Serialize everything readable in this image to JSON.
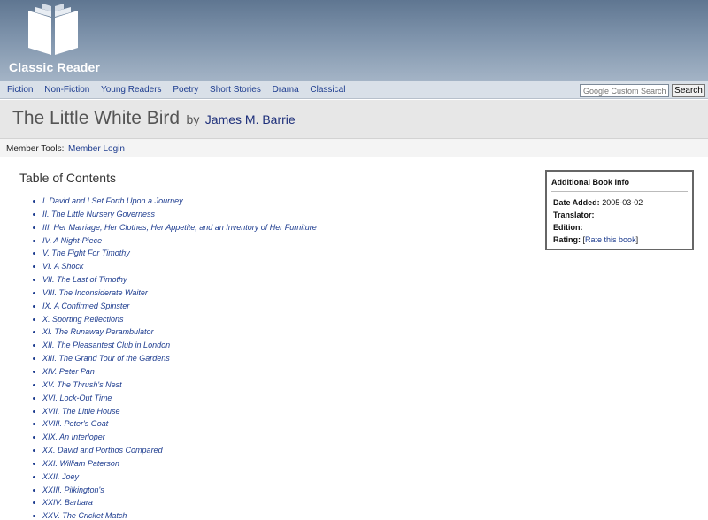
{
  "header": {
    "logo_text": "Classic Reader"
  },
  "nav": {
    "links": [
      "Fiction",
      "Non-Fiction",
      "Young Readers",
      "Poetry",
      "Short Stories",
      "Drama",
      "Classical"
    ],
    "search_placeholder": "Google Custom Search",
    "search_button": "Search"
  },
  "book": {
    "title": "The Little White Bird",
    "by": "by",
    "author": "James M. Barrie"
  },
  "member": {
    "label": "Member Tools:",
    "login": "Member Login"
  },
  "toc": {
    "heading": "Table of Contents",
    "chapters": [
      "I. David and I Set Forth Upon a Journey",
      "II. The Little Nursery Governess",
      "III. Her Marriage, Her Clothes, Her Appetite, and an Inventory of Her Furniture",
      "IV. A Night-Piece",
      "V. The Fight For Timothy",
      "VI. A Shock",
      "VII. The Last of Timothy",
      "VIII. The Inconsiderate Waiter",
      "IX. A Confirmed Spinster",
      "X. Sporting Reflections",
      "XI. The Runaway Perambulator",
      "XII. The Pleasantest Club in London",
      "XIII. The Grand Tour of the Gardens",
      "XIV. Peter Pan",
      "XV. The Thrush's Nest",
      "XVI. Lock-Out Time",
      "XVII. The Little House",
      "XVIII. Peter's Goat",
      "XIX. An Interloper",
      "XX. David and Porthos Compared",
      "XXI. William Paterson",
      "XXII. Joey",
      "XXIII. Pilkington's",
      "XXIV. Barbara",
      "XXV. The Cricket Match"
    ]
  },
  "info": {
    "heading": "Additional Book Info",
    "date_added_label": "Date Added:",
    "date_added_value": "2005-03-02",
    "translator_label": "Translator:",
    "edition_label": "Edition:",
    "rating_label": "Rating:",
    "rate_open": "[",
    "rate_link": "Rate this book",
    "rate_close": "]"
  }
}
